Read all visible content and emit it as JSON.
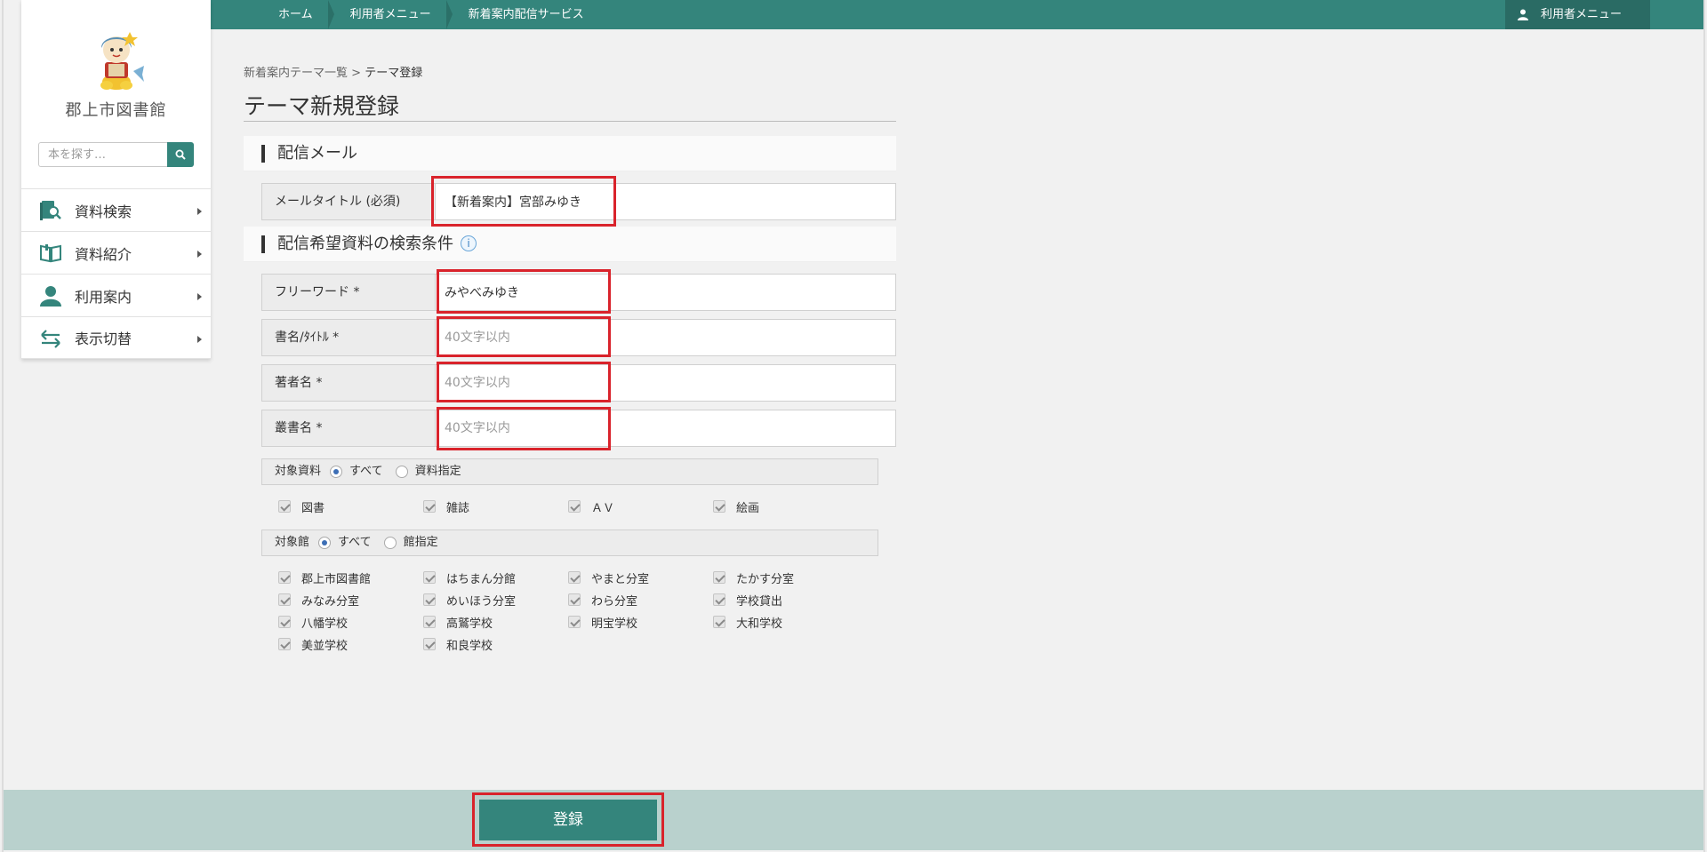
{
  "topnav": {
    "crumbs": [
      "ホーム",
      "利用者メニュー",
      "新着案内配信サービス"
    ],
    "user_menu": "利用者メニュー"
  },
  "sidebar": {
    "library_name": "郡上市図書館",
    "search_placeholder": "本を探す…",
    "items": [
      {
        "label": "資料検索",
        "icon": "book-search-icon"
      },
      {
        "label": "資料紹介",
        "icon": "open-book-icon"
      },
      {
        "label": "利用案内",
        "icon": "person-icon"
      },
      {
        "label": "表示切替",
        "icon": "swap-arrows-icon"
      }
    ]
  },
  "breadcrumb": {
    "parent": "新着案内テーマ一覧",
    "separator": ">",
    "current": "テーマ登録"
  },
  "page_title": "テーマ新規登録",
  "sections": {
    "mail": "配信メール",
    "criteria": "配信希望資料の検索条件"
  },
  "fields": {
    "mail_title": {
      "label": "メールタイトル (必須)",
      "value": "【新着案内】宮部みゆき"
    },
    "free_word": {
      "label": "フリーワード *",
      "value": "みやべみゆき"
    },
    "book_title": {
      "label": "書名/ﾀｲﾄﾙ *",
      "placeholder": "40文字以内"
    },
    "author": {
      "label": "著者名 *",
      "placeholder": "40文字以内"
    },
    "series": {
      "label": "叢書名 *",
      "placeholder": "40文字以内"
    }
  },
  "material": {
    "label": "対象資料",
    "options": [
      "すべて",
      "資料指定"
    ],
    "selected": "すべて",
    "checks": [
      "図書",
      "雑誌",
      "ＡＶ",
      "絵画"
    ]
  },
  "branch": {
    "label": "対象館",
    "options": [
      "すべて",
      "館指定"
    ],
    "selected": "すべて",
    "checks": [
      "郡上市図書館",
      "はちまん分館",
      "やまと分室",
      "たかす分室",
      "みなみ分室",
      "めいほう分室",
      "わら分室",
      "学校貸出",
      "八幡学校",
      "高鷲学校",
      "明宝学校",
      "大和学校",
      "美並学校",
      "和良学校"
    ]
  },
  "submit_label": "登録",
  "colors": {
    "accent": "#34857c",
    "highlight": "#d9232b",
    "footer": "#b9d1cd"
  }
}
